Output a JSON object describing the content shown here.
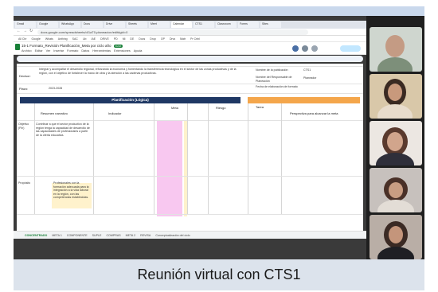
{
  "browser": {
    "tabs": [
      "Gmail",
      "Google",
      "WhatsApp",
      "Docs",
      "Drive",
      "Sheets",
      "Meet",
      "Calendar",
      "CTS1",
      "Classroom",
      "Forms",
      "Sites"
    ],
    "url": "docs.google.com/spreadsheets/d/1aT0-planeacion/edit#gid=0",
    "bookmarks": [
      "All Chr",
      "Google",
      "Whats",
      "Anthing",
      "SAC",
      "Lib",
      "IAE",
      "DRIVE",
      "PD",
      "Mi",
      "DE",
      "Docs",
      "Drop",
      "OP",
      "Drvs",
      "Matr",
      "Pr Crtnl"
    ]
  },
  "document": {
    "title": "15-1 Formato_Revisión Planificación_Meta por ciclo año",
    "badge": "XLSX",
    "menus": [
      "Archivo",
      "Editar",
      "Ver",
      "Insertar",
      "Formato",
      "Datos",
      "Herramientas",
      "Extensiones",
      "Ayuda"
    ]
  },
  "sheet": {
    "row1_label": "Decisor:",
    "row1_text": "Integrar y acompañar el desarrollo regional, reforzando la economía y fomentando la transferencia tecnológica en el sector de las zonas productivas y de la región, con el objetivo de fortalecer la mano de obra y la atención a las cadenas productivas.",
    "row2_label": "Plazo:",
    "row2_value": "2023-2028",
    "side_labels": [
      "Nombre de la publicación",
      "Nombre del Responsable de Planeación",
      "Fecha de elaboración de formato"
    ],
    "side_values": [
      "CTS1",
      "Planeador",
      "",
      ""
    ],
    "section_header": "Planificación (Lógica)",
    "col_header_1": "Resumen narrativo",
    "col_header_2": "Indicador",
    "col_header_3": "Meta",
    "col_header_4": "Riesgo",
    "right_header": "Tarea",
    "right_col_header": "Perspectiva para alcanzar la meta",
    "rows": [
      {
        "id": "Objetivo (Fin)",
        "text": "Contribuir a que el sector productivo de la región tenga la capacidad de desarrollo de las capacidades de profesionales a partir de la oferta educativa."
      },
      {
        "id": "Propósito",
        "text": "Profesionales con la formación adecuada para la integración a la vida laboral en la región, con las competencias establecidas."
      }
    ],
    "sheet_tabs": [
      "CONCENTRADO",
      "META 1",
      "COMPONENTE",
      "SUPLE",
      "COMPRAS",
      "META 2",
      "REVISA",
      "Conceptualización del ciclo"
    ]
  },
  "participants": [
    {
      "name": "participant-1"
    },
    {
      "name": "participant-2"
    },
    {
      "name": "participant-3"
    },
    {
      "name": "participant-4"
    },
    {
      "name": "participant-5"
    }
  ],
  "caption": "Reunión virtual con CTS1"
}
